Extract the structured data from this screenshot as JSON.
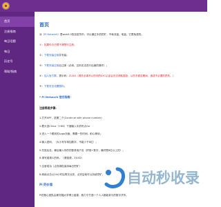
{
  "colors": {
    "brand": "#6e2e90",
    "sidebar": "#5f2682",
    "sidebar_active": "#8141a6",
    "link": "#2c6fd1",
    "red": "#e3262b",
    "logo": "#f4b41a",
    "text": "#333333",
    "watermark": "#8db0cc",
    "watermark_logo": "#2f80d0"
  },
  "header": {
    "logo_icon": "pi-logo-icon"
  },
  "sidebar": {
    "items": [
      {
        "label": "首页",
        "active": true
      },
      {
        "label": "注册指南"
      },
      {
        "label": "每日话题"
      },
      {
        "label": "每日"
      },
      {
        "label": "历史号"
      },
      {
        "label": "帮助/指南"
      }
    ]
  },
  "main": {
    "title": "首页",
    "intro": {
      "prefix": "派（",
      "link": "Pi Network",
      "suffix": "）是web3.0的加密货币，可以通过手机挖矿，不耗流量、电量。它是免费的。"
    },
    "notice": "①：如果你今日想不清楚可注册。",
    "tasks": [
      {
        "num": "②：",
        "link": "下载安装应用",
        "text": "并安装；"
      },
      {
        "num": "③：",
        "link": "下载安装应用",
        "text": "后注册（必填，否则无法进行后面的操作）；"
      },
      {
        "num": "④：",
        "link": "加入官方群",
        "text": "，提示码：",
        "highlight": "ZUXD（请务必填写以防你的KYC认证后无法领取奖励，以防不稳定期间，造成不必要的损失。）"
      },
      {
        "num": "⑤：",
        "link": "下载安全设置图标",
        "text": "；"
      }
    ],
    "guide_heading": "* Pi Network 信任指南：",
    "steps_heading": "注册简易步骤:",
    "steps": [
      "1.打开APP，选第二个(Continue with phone number)",
      "2.着头选China（+86）下面输入手机号点Go",
      "3.进入一个看到的Logo页面，需要一些时间，耐心等待；",
      "4.输入密码，（大小写字母加数字，不能少于8位）；",
      "5.先姓后名，最后输入你的的登录用户名（拼音+数字，最好是8位以上的）；",
      "6.请写邀请人的码，（请邀请，ZUXD）",
      "7.注册成功（点亮绿色保持每日挖矿）",
      "8.继续点击以24小时后再次点亮，点完后就可以持续挖矿。"
    ],
    "value_heading": "Pi 的价值",
    "value_text": "Pi的核心团队由斯坦福大学博士组建，致力于打造一个人人都能参与的数字货币。"
  },
  "watermark": {
    "logo_icon": "auto-index-logo-icon",
    "text": "自动秒收录"
  }
}
